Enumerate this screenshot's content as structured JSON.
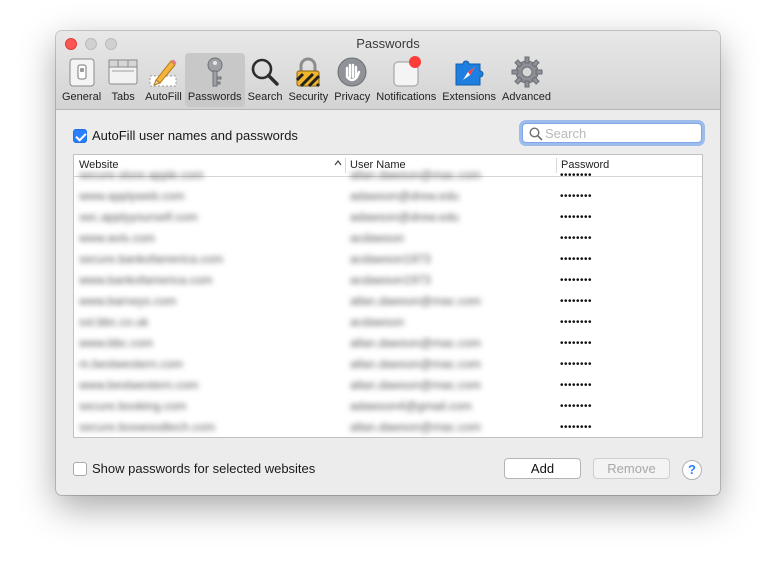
{
  "window": {
    "title": "Passwords"
  },
  "toolbar": {
    "items": [
      {
        "label": "General",
        "icon": "switch-icon"
      },
      {
        "label": "Tabs",
        "icon": "tabs-icon"
      },
      {
        "label": "AutoFill",
        "icon": "pencil-form-icon"
      },
      {
        "label": "Passwords",
        "icon": "key-icon",
        "active": true
      },
      {
        "label": "Search",
        "icon": "magnifier-icon"
      },
      {
        "label": "Security",
        "icon": "padlock-icon"
      },
      {
        "label": "Privacy",
        "icon": "hand-icon"
      },
      {
        "label": "Notifications",
        "icon": "notification-badge-icon"
      },
      {
        "label": "Extensions",
        "icon": "puzzle-compass-icon"
      },
      {
        "label": "Advanced",
        "icon": "gear-icon"
      }
    ]
  },
  "autofill": {
    "label": "AutoFill user names and passwords",
    "checked": true
  },
  "search": {
    "placeholder": "Search",
    "value": ""
  },
  "table": {
    "columns": [
      "Website",
      "User Name",
      "Password"
    ],
    "sort_column": "Website",
    "sort_direction": "ascending",
    "rows": [
      {
        "website": "secure.store.apple.com",
        "username": "allan.dawson@mac.com",
        "password": "••••••••"
      },
      {
        "website": "www.applyweb.com",
        "username": "adawson@drew.edu",
        "password": "••••••••"
      },
      {
        "website": "sec.applyyourself.com",
        "username": "adawson@drew.edu",
        "password": "••••••••"
      },
      {
        "website": "www.avis.com",
        "username": "acdawson",
        "password": "••••••••"
      },
      {
        "website": "secure.bankofamerica.com",
        "username": "acdawson1973",
        "password": "••••••••"
      },
      {
        "website": "www.bankofamerica.com",
        "username": "acdawson1973",
        "password": "••••••••"
      },
      {
        "website": "www.barneys.com",
        "username": "allan.dawson@mac.com",
        "password": "••••••••"
      },
      {
        "website": "ssl.bbc.co.uk",
        "username": "acdawson",
        "password": "••••••••"
      },
      {
        "website": "www.bbc.com",
        "username": "allan.dawson@mac.com",
        "password": "••••••••"
      },
      {
        "website": "m.bestwestern.com",
        "username": "allan.dawson@mac.com",
        "password": "••••••••"
      },
      {
        "website": "www.bestwestern.com",
        "username": "allan.dawson@mac.com",
        "password": "••••••••"
      },
      {
        "website": "secure.booking.com",
        "username": "adawson4@gmail.com",
        "password": "••••••••"
      },
      {
        "website": "secure.boxwoodtech.com",
        "username": "allan.dawson@mac.com",
        "password": "••••••••"
      }
    ]
  },
  "show_passwords": {
    "label": "Show passwords for selected websites",
    "checked": false
  },
  "buttons": {
    "add": "Add",
    "remove": "Remove",
    "help": "?"
  },
  "colors": {
    "accent": "#2a7fff",
    "close": "#fc5753",
    "notification_dot": "#fc3d39"
  }
}
